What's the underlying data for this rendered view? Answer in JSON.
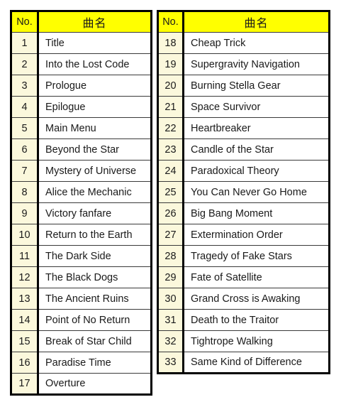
{
  "page": {
    "background_color": "#ffffff",
    "header_fill": "#ffff00",
    "no_cell_fill": "#fbf8dc",
    "title_cell_fill": "#ffffff",
    "border_color": "#000000",
    "text_color": "#1a1a1a"
  },
  "tables": [
    {
      "id": "left",
      "headers": {
        "no": "No.",
        "title": "曲名"
      },
      "rows": [
        {
          "no": "1",
          "title": "Title"
        },
        {
          "no": "2",
          "title": "Into the Lost Code"
        },
        {
          "no": "3",
          "title": "Prologue"
        },
        {
          "no": "4",
          "title": "Epilogue"
        },
        {
          "no": "5",
          "title": "Main Menu"
        },
        {
          "no": "6",
          "title": "Beyond the Star"
        },
        {
          "no": "7",
          "title": "Mystery of Universe"
        },
        {
          "no": "8",
          "title": "Alice the Mechanic"
        },
        {
          "no": "9",
          "title": "Victory fanfare"
        },
        {
          "no": "10",
          "title": "Return to the Earth"
        },
        {
          "no": "11",
          "title": "The Dark Side"
        },
        {
          "no": "12",
          "title": "The Black Dogs"
        },
        {
          "no": "13",
          "title": "The Ancient Ruins"
        },
        {
          "no": "14",
          "title": "Point of No Return"
        },
        {
          "no": "15",
          "title": "Break of Star Child"
        },
        {
          "no": "16",
          "title": "Paradise Time"
        },
        {
          "no": "17",
          "title": "Overture"
        }
      ]
    },
    {
      "id": "right",
      "headers": {
        "no": "No.",
        "title": "曲名"
      },
      "rows": [
        {
          "no": "18",
          "title": "Cheap Trick"
        },
        {
          "no": "19",
          "title": "Supergravity Navigation"
        },
        {
          "no": "20",
          "title": "Burning Stella Gear"
        },
        {
          "no": "21",
          "title": "Space Survivor"
        },
        {
          "no": "22",
          "title": "Heartbreaker"
        },
        {
          "no": "23",
          "title": "Candle of the Star"
        },
        {
          "no": "24",
          "title": "Paradoxical Theory"
        },
        {
          "no": "25",
          "title": "You Can Never Go Home"
        },
        {
          "no": "26",
          "title": "Big Bang Moment"
        },
        {
          "no": "27",
          "title": "Extermination Order"
        },
        {
          "no": "28",
          "title": "Tragedy of Fake Stars"
        },
        {
          "no": "29",
          "title": "Fate of Satellite"
        },
        {
          "no": "30",
          "title": "Grand Cross is Awaking"
        },
        {
          "no": "31",
          "title": "Death to the Traitor"
        },
        {
          "no": "32",
          "title": "Tightrope Walking"
        },
        {
          "no": "33",
          "title": "Same Kind of Difference"
        }
      ]
    }
  ]
}
